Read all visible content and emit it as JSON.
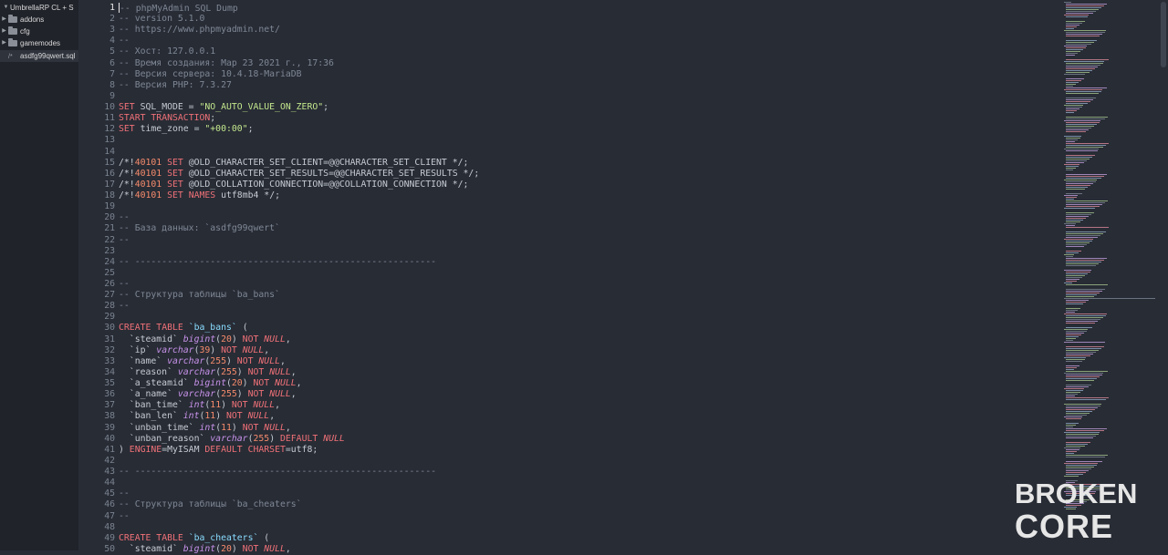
{
  "sidebar": {
    "root": "UmbrellaRP CL + S",
    "items": [
      {
        "label": "addons",
        "kind": "folder",
        "icon": "folder-icon"
      },
      {
        "label": "cfg",
        "kind": "folder",
        "icon": "folder-icon"
      },
      {
        "label": "gamemodes",
        "kind": "folder",
        "icon": "folder-icon"
      },
      {
        "label": "asdfg99qwert.sql",
        "kind": "file",
        "icon": "comment-file-icon",
        "glyph": "/*"
      }
    ]
  },
  "editor": {
    "active_line": 1,
    "lines": [
      "-- phpMyAdmin SQL Dump",
      "-- version 5.1.0",
      "-- https://www.phpmyadmin.net/",
      "--",
      "-- Хост: 127.0.0.1",
      "-- Время создания: Мар 23 2021 г., 17:36",
      "-- Версия сервера: 10.4.18-MariaDB",
      "-- Версия PHP: 7.3.27",
      "",
      "SET SQL_MODE = \"NO_AUTO_VALUE_ON_ZERO\";",
      "START TRANSACTION;",
      "SET time_zone = \"+00:00\";",
      "",
      "",
      "/*!40101 SET @OLD_CHARACTER_SET_CLIENT=@@CHARACTER_SET_CLIENT */;",
      "/*!40101 SET @OLD_CHARACTER_SET_RESULTS=@@CHARACTER_SET_RESULTS */;",
      "/*!40101 SET @OLD_COLLATION_CONNECTION=@@COLLATION_CONNECTION */;",
      "/*!40101 SET NAMES utf8mb4 */;",
      "",
      "--",
      "-- База данных: `asdfg99qwert`",
      "--",
      "",
      "-- --------------------------------------------------------",
      "",
      "--",
      "-- Структура таблицы `ba_bans`",
      "--",
      "",
      "CREATE TABLE `ba_bans` (",
      "  `steamid` bigint(20) NOT NULL,",
      "  `ip` varchar(39) NOT NULL,",
      "  `name` varchar(255) NOT NULL,",
      "  `reason` varchar(255) NOT NULL,",
      "  `a_steamid` bigint(20) NOT NULL,",
      "  `a_name` varchar(255) NOT NULL,",
      "  `ban_time` int(11) NOT NULL,",
      "  `ban_len` int(11) NOT NULL,",
      "  `unban_time` int(11) NOT NULL,",
      "  `unban_reason` varchar(255) DEFAULT NULL",
      ") ENGINE=MyISAM DEFAULT CHARSET=utf8;",
      "",
      "-- --------------------------------------------------------",
      "",
      "--",
      "-- Структура таблицы `ba_cheaters`",
      "--",
      "",
      "CREATE TABLE `ba_cheaters` (",
      "  `steamid` bigint(20) NOT NULL,"
    ]
  },
  "watermark": {
    "line1": "BROKEN",
    "line2": "CORE"
  },
  "colors": {
    "background": "#282c35",
    "sidebar": "#20232a",
    "comment": "#7f8896",
    "keyword": "#f07178",
    "string": "#c3e88d",
    "type": "#c792ea",
    "table_name": "#89ddff"
  }
}
